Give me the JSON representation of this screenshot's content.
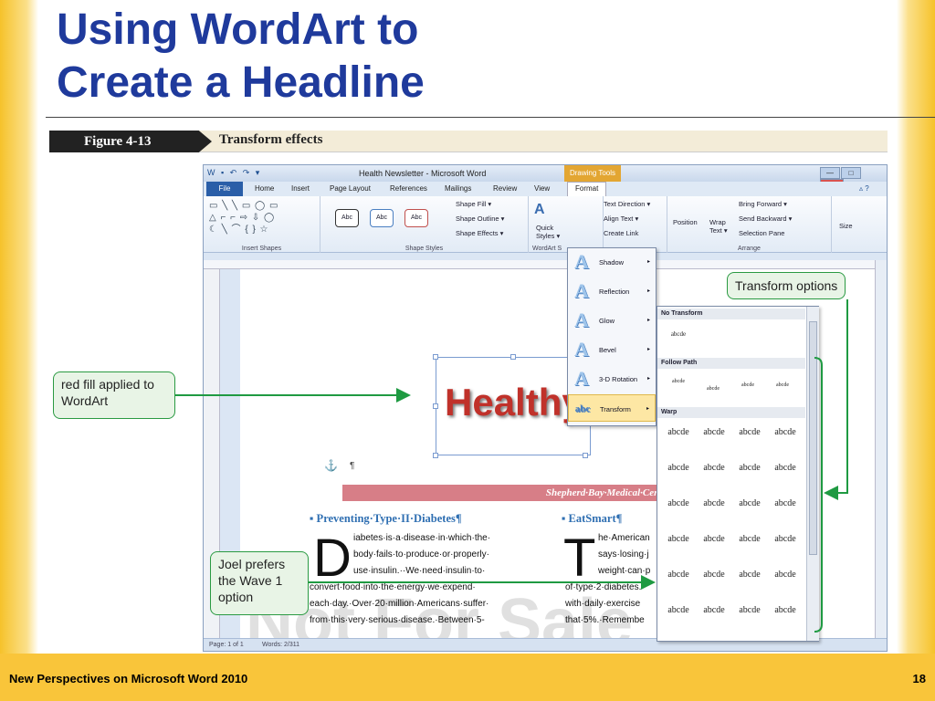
{
  "slide": {
    "title_line1": "Using WordArt to",
    "title_line2": "Create a Headline"
  },
  "figure": {
    "number": "Figure 4-13",
    "title": "Transform effects"
  },
  "window": {
    "quick_access": "W ▪ ↶ ↷ ▾",
    "title": "Health Newsletter - Microsoft Word",
    "drawing_tools": "Drawing Tools",
    "min_glyph": "—",
    "max_glyph": "□",
    "close_glyph": "✕",
    "help_glyph": "▵ ?"
  },
  "tabs": [
    "File",
    "Home",
    "Insert",
    "Page Layout",
    "References",
    "Mailings",
    "Review",
    "View",
    "Format"
  ],
  "ribbon": {
    "abc": "Abc",
    "shape_fill": "Shape Fill ▾",
    "shape_outline": "Shape Outline ▾",
    "shape_effects": "Shape Effects ▾",
    "quick_styles_glyph": "A",
    "quick_styles_line1": "Quick",
    "quick_styles_line2": "Styles ▾",
    "text_direction": "Text Direction ▾",
    "align_text": "Align Text ▾",
    "create_link": "Create Link",
    "position": "Position",
    "wrap": "Wrap",
    "wrap_sub": "Text ▾",
    "bring_forward": "Bring Forward ▾",
    "send_backward": "Send Backward ▾",
    "selection_pane": "Selection Pane",
    "size": "Size",
    "groups": {
      "insert_shapes": "Insert Shapes",
      "shape_styles": "Shape Styles",
      "wordart_styles": "WordArt S",
      "arrange": "Arrange"
    }
  },
  "menu": {
    "items": [
      "Shadow",
      "Reflection",
      "Glow",
      "Bevel",
      "3-D Rotation",
      "Transform"
    ],
    "icon_glyph": "A",
    "transform_icon": "abc",
    "arrow": "▸"
  },
  "gallery": {
    "no_transform": "No Transform",
    "sample_small": "abcde",
    "follow_path": "Follow Path",
    "path": [
      "abcde",
      "abcde",
      "abcde",
      "abcde"
    ],
    "warp": "Warp",
    "warp_cells": [
      "abcde",
      "abcde",
      "abcde",
      "abcde",
      "abcde",
      "abcde",
      "abcde",
      "abcde",
      "abcde",
      "abcde",
      "abcde",
      "abcde",
      "abcde",
      "abcde",
      "abcde",
      "abcde",
      "abcde",
      "abcde",
      "abcde",
      "abcde",
      "abcde",
      "abcde",
      "abcde",
      "abcde"
    ]
  },
  "doc": {
    "wordart": "Healthy",
    "anchor_glyph": "⚓",
    "pilcrow": "¶",
    "masthead": "Shepherd·Bay·Medical·Center¶....",
    "heading1": "▪ Preventing·Type·II·Diabetes¶",
    "dropcap1": "D",
    "col1": [
      "iabetes·is·a·disease·in·which·the·",
      "body·fails·to·produce·or·properly·",
      "use·insulin.··We·need·insulin·to·",
      "convert·food·into·the·energy·we·expend·",
      "each·day.·Over·20·million·Americans·suffer·",
      "from·this·very·serious·disease.·Between·5-"
    ],
    "heading2": "▪ EatSmart¶",
    "dropcap2": "T",
    "col2": [
      "he·American",
      "says·losing·j",
      "weight·can·p",
      "of·type·2·diabetes.",
      "with·daily·exercise",
      "that·5%.·Remembe"
    ],
    "watermark": "Not For Sale"
  },
  "status": {
    "page": "Page: 1 of 1",
    "words": "Words: 2/311"
  },
  "callouts": {
    "transform": "Transform options",
    "red_fill": "red fill applied to WordArt",
    "wave": "Joel prefers the Wave 1 option"
  },
  "footer": {
    "left": "New Perspectives on Microsoft Word 2010",
    "page": "18"
  }
}
